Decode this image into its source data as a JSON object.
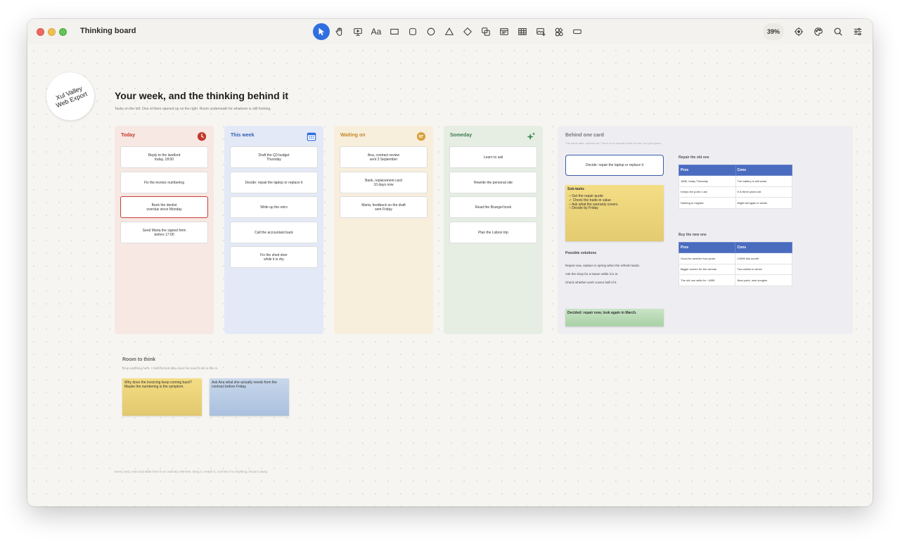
{
  "window": {
    "title": "Thinking board"
  },
  "toolbar": {
    "zoom": "39%",
    "text_tool_label": "Aa"
  },
  "logo": {
    "line1": "Xul Valley",
    "line2": "Web Export"
  },
  "board": {
    "title": "Your week, and the thinking behind it",
    "subtitle": "Tasks on the left. One of them opened up on the right. Room underneath for whatever is still forming."
  },
  "columns": [
    {
      "title": "Today",
      "color": "#c0392b",
      "bg": "#f8e8e3",
      "icon": "clock-icon",
      "cards": [
        "Reply to the landlord\ntoday, 18:00",
        "Fix the invoice numbering",
        "Book the dentist\noverdue since Monday",
        "Send Marta the signed form\nbefore 17:00"
      ]
    },
    {
      "title": "This week",
      "color": "#2f5fb3",
      "bg": "#e4e9f7",
      "icon": "calendar-icon",
      "cards": [
        "Draft the Q3 budget\nThursday",
        "Decide: repair the laptop or replace it",
        "Write up the retro",
        "Call the accountant back",
        "Fix the shed door\nwhile it is dry"
      ]
    },
    {
      "title": "Waiting on",
      "color": "#c4862a",
      "bg": "#f8eedc",
      "icon": "speech-bubble-icon",
      "cards": [
        "Ana, contract review\nsent 3 September",
        "Bank, replacement card\n10 days now",
        "Marta, feedback on the draft\nsent Friday"
      ]
    },
    {
      "title": "Someday",
      "color": "#3e7a4f",
      "bg": "#e6eee4",
      "icon": "sparkle-icon",
      "cards": [
        "Learn to sail",
        "Rewrite the personal site",
        "Read the Bruegel book",
        "Plan the Lisbon trip"
      ]
    }
  ],
  "detail": {
    "title": "Behind one card",
    "subtitle": "The same task, opened out. There is no special mode for this. It is just space.",
    "selected_card": "Decide: repair the laptop or replace it",
    "subtasks_title": "Sub-tasks",
    "subtasks": [
      {
        "mark": "○",
        "text": "Get the repair quote"
      },
      {
        "mark": "✓",
        "text": "Check the trade-in value"
      },
      {
        "mark": "○",
        "text": "Ask what the warranty covers"
      },
      {
        "mark": "○",
        "text": "Decide by Friday"
      }
    ],
    "solutions_title": "Possible solutions",
    "solutions": [
      "Repair now, replace in spring when the refresh lands.",
      "Ask the shop for a loaner while it is in.",
      "Check whether work covers half of it."
    ],
    "decided": "Decided: repair now, look again in March.",
    "repair": {
      "label": "Repair the old one",
      "headers": [
        "Pros",
        "Cons"
      ],
      "rows": [
        [
          "180€, ready Thursday",
          "The battery is still weak"
        ],
        [
          "Keeps the ports I use",
          "It is three years old"
        ],
        [
          "Nothing to migrate",
          "Might fail again in winter"
        ]
      ]
    },
    "buy": {
      "label": "Buy the new one",
      "headers": [
        "Pros",
        "Cons"
      ],
      "rows": [
        [
          "Good for another four years",
          "1400€ this month"
        ],
        [
          "Bigger screen for the canvas",
          "Two weeks to arrive"
        ],
        [
          "The old one sells for ~400€",
          "New ports, new dongles"
        ]
      ]
    }
  },
  "room": {
    "title": "Room to think",
    "subtitle": "Drop anything here. A half-formed idea does not need a list to live in.",
    "notes": [
      {
        "text": "Why does the invoicing keep coming back?\nMaybe the numbering is the symptom.",
        "color": "yellow"
      },
      {
        "text": "Ask Ana what she actually needs from the\ncontract before Friday.",
        "color": "blue"
      }
    ]
  },
  "footer": "Every card, note and table here is an ordinary element. Drag it, restyle it, connect it to anything, throw it away."
}
